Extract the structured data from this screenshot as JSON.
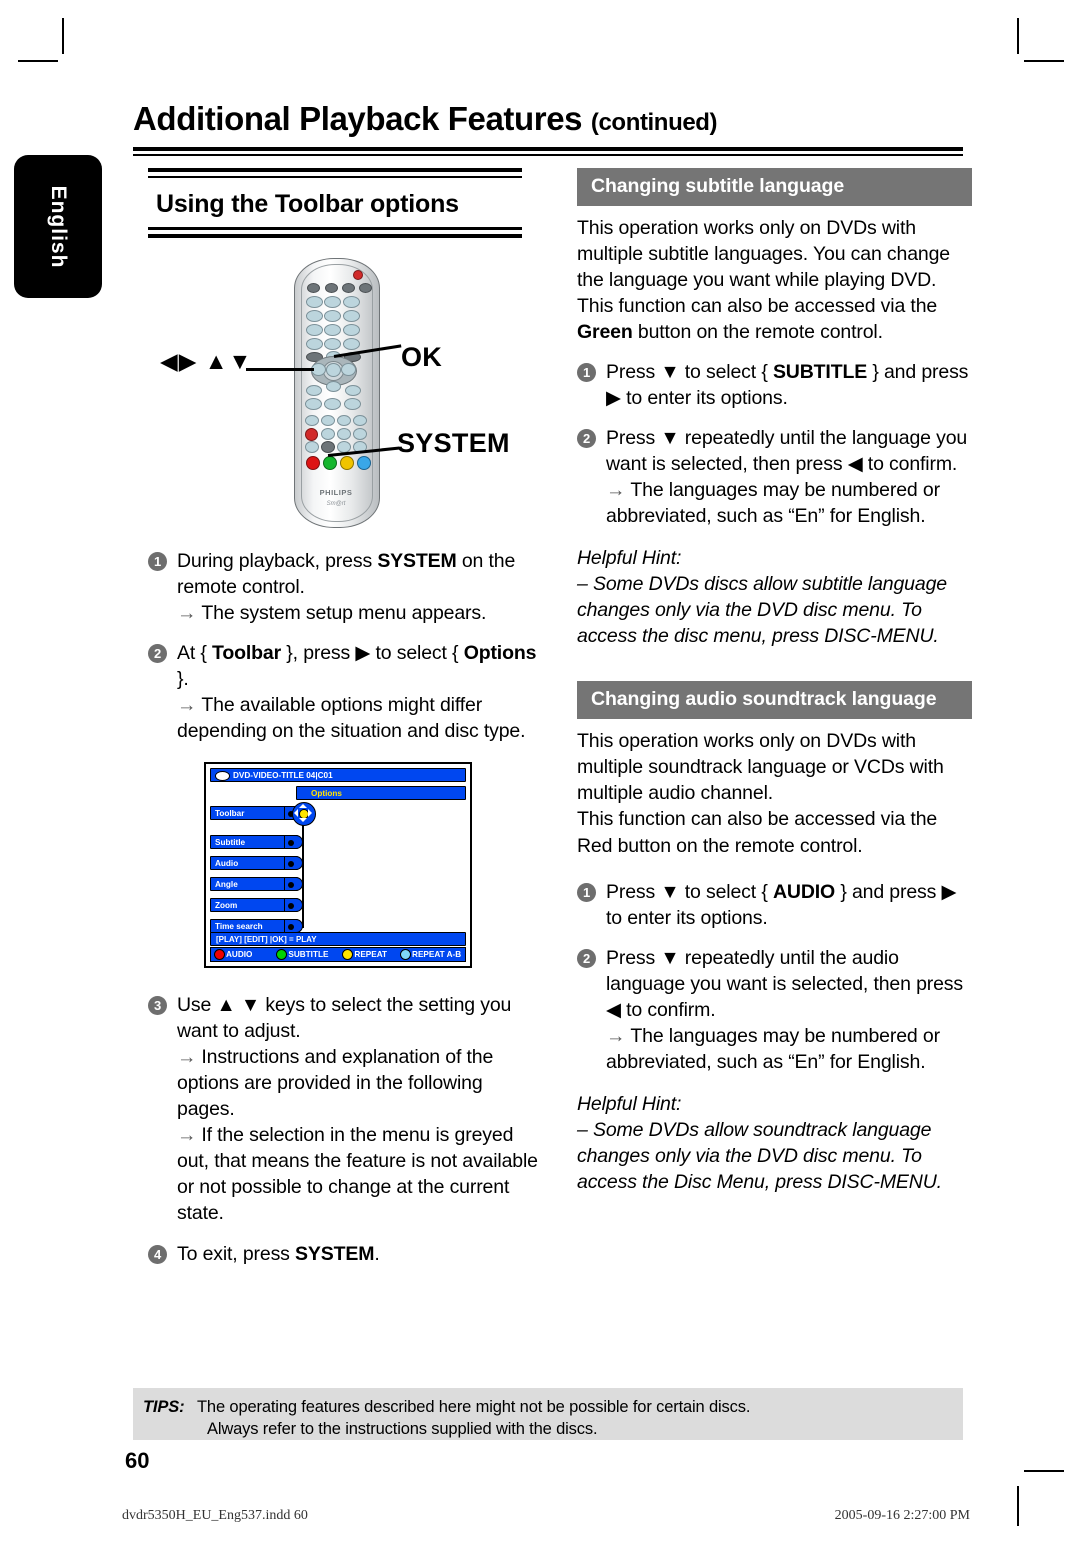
{
  "page": {
    "chapter_title": "Additional Playback Features",
    "chapter_title_suffix": "(continued)",
    "language_tab": "English",
    "page_number": "60",
    "footer_file": "dvdr5350H_EU_Eng537.indd   60",
    "footer_date": "2005-09-16   2:27:00 PM"
  },
  "left_column": {
    "section_heading": "Using the Toolbar options",
    "remote": {
      "dpad_glyphs": "◀▶ ▲▼",
      "ok_label": "OK",
      "system_label": "SYSTEM",
      "brand": "PHILIPS",
      "brand_sub": "Sm@rt"
    },
    "steps": [
      {
        "num": "1",
        "text_html": "During playback, press <b>SYSTEM</b> on the remote control.",
        "subs": [
          "The system setup menu appears."
        ]
      },
      {
        "num": "2",
        "text_html": "At { <b>Toolbar</b> }, press ▶ to select { <b>Options</b> }.",
        "subs": [
          "The available options might differ depending on the situation and disc type."
        ]
      },
      {
        "num": "3",
        "text_html": "Use ▲ ▼ keys to select the setting you want to adjust.",
        "subs": [
          "Instructions and explanation of the options are provided in the following pages.",
          "If the selection in the menu is greyed out, that means the feature is not available or not possible to change at the current state."
        ]
      },
      {
        "num": "4",
        "text_html": "To exit, press <b>SYSTEM</b>.",
        "subs": []
      }
    ],
    "osd": {
      "title": "DVD-VIDEO-TITLE 04|C01",
      "options_label": "Options",
      "menu_items": [
        "Toolbar",
        "Subtitle",
        "Audio",
        "Angle",
        "Zoom",
        "Time search"
      ],
      "status_line": "[PLAY] [EDIT] |OK] = PLAY",
      "color_buttons": [
        {
          "label": "AUDIO",
          "color": "#ee0000"
        },
        {
          "label": "SUBTITLE",
          "color": "#00d400"
        },
        {
          "label": "REPEAT",
          "color": "#ffe400"
        },
        {
          "label": "REPEAT A-B",
          "color": "#7fd8f7"
        }
      ]
    }
  },
  "right_column": {
    "subtitle_section": {
      "heading": "Changing subtitle language",
      "paragraphs": [
        "This operation works only on DVDs with multiple subtitle languages. You can change the language you want while playing DVD.",
        "This function can also be accessed via the <b>Green</b> button on the remote control."
      ],
      "steps": [
        {
          "num": "1",
          "text_html": "Press ▼ to select { <b>SUBTITLE</b> } and press ▶ to enter its options.",
          "subs": []
        },
        {
          "num": "2",
          "text_html": "Press ▼ repeatedly until the language you want is selected, then press ◀ to confirm.",
          "subs": [
            "The languages may be numbered or abbreviated, such as “En” for English."
          ]
        }
      ],
      "hint_title": "Helpful Hint:",
      "hint_body": "– Some DVDs discs allow subtitle language changes only via the DVD disc menu. To access the disc menu, press DISC-MENU."
    },
    "audio_section": {
      "heading": "Changing audio soundtrack language",
      "paragraphs": [
        "This operation works only on DVDs with multiple soundtrack language or VCDs with multiple audio channel.",
        "This function can also be accessed via the Red button on the remote control."
      ],
      "steps": [
        {
          "num": "1",
          "text_html": "Press ▼ to select { <b>AUDIO</b> } and press ▶ to enter its options.",
          "subs": []
        },
        {
          "num": "2",
          "text_html": "Press ▼ repeatedly until the audio language you want is selected, then press ◀ to confirm.",
          "subs": [
            "The languages may be numbered or abbreviated, such as “En” for English."
          ]
        }
      ],
      "hint_title": "Helpful Hint:",
      "hint_body": "– Some DVDs allow soundtrack language changes only via the DVD disc menu. To access the Disc Menu, press DISC-MENU."
    }
  },
  "tips": {
    "label": "TIPS:",
    "line1": "The operating features described here might not be possible for certain discs.",
    "line2": "Always refer to the instructions supplied with the discs."
  }
}
